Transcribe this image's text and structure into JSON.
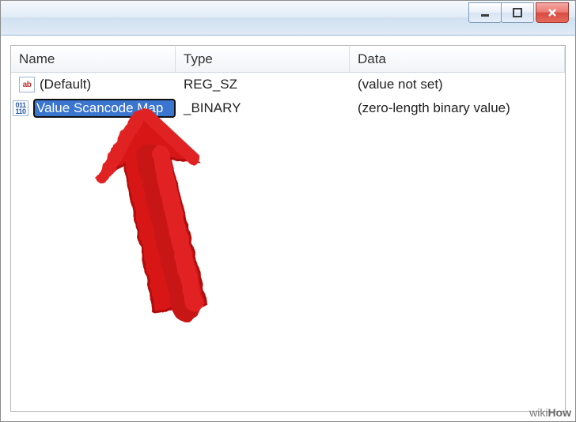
{
  "columns": {
    "name": "Name",
    "type": "Type",
    "data": "Data"
  },
  "rows": [
    {
      "icon": "ab",
      "name": "(Default)",
      "type": "REG_SZ",
      "data": "(value not set)",
      "editing": false
    },
    {
      "icon": "binary",
      "name_editing_value": "Value Scancode Map",
      "type": "_BINARY",
      "data": "(zero-length binary value)",
      "editing": true
    }
  ],
  "watermark": {
    "prefix": "wiki",
    "suffix": "How"
  }
}
